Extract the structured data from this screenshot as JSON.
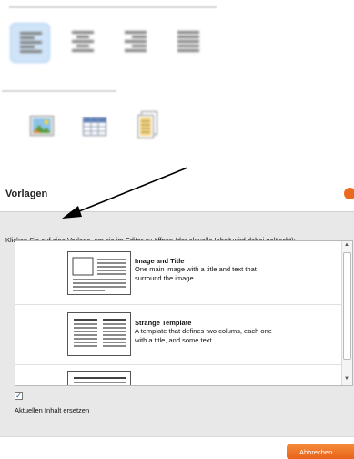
{
  "toolbar": {
    "alignment_buttons": [
      {
        "name": "align-left",
        "active": true
      },
      {
        "name": "align-center",
        "active": false
      },
      {
        "name": "align-right",
        "active": false
      },
      {
        "name": "align-justify",
        "active": false
      }
    ],
    "insert_buttons": [
      "image-icon",
      "table-icon",
      "templates-icon"
    ]
  },
  "dialog": {
    "title": "Vorlagen",
    "instruction": "Klicken Sie auf eine Vorlage, um sie im Editor zu öffnen (der aktuelle Inhalt wird dabei gelöscht):",
    "templates": [
      {
        "title": "Image and Title",
        "description": "One main image with a title and text that surround the image."
      },
      {
        "title": "Strange Template",
        "description": "A template that defines two colums, each one with a title, and some text."
      }
    ],
    "replace_checkbox": {
      "checked": true,
      "mark": "✓",
      "label": "Aktuellen Inhalt ersetzen"
    },
    "cancel_label": "Abbrechen",
    "colors": {
      "accent": "#ea6b1e",
      "panel": "#e8e8e8",
      "active_button": "#cfe4f8"
    }
  }
}
